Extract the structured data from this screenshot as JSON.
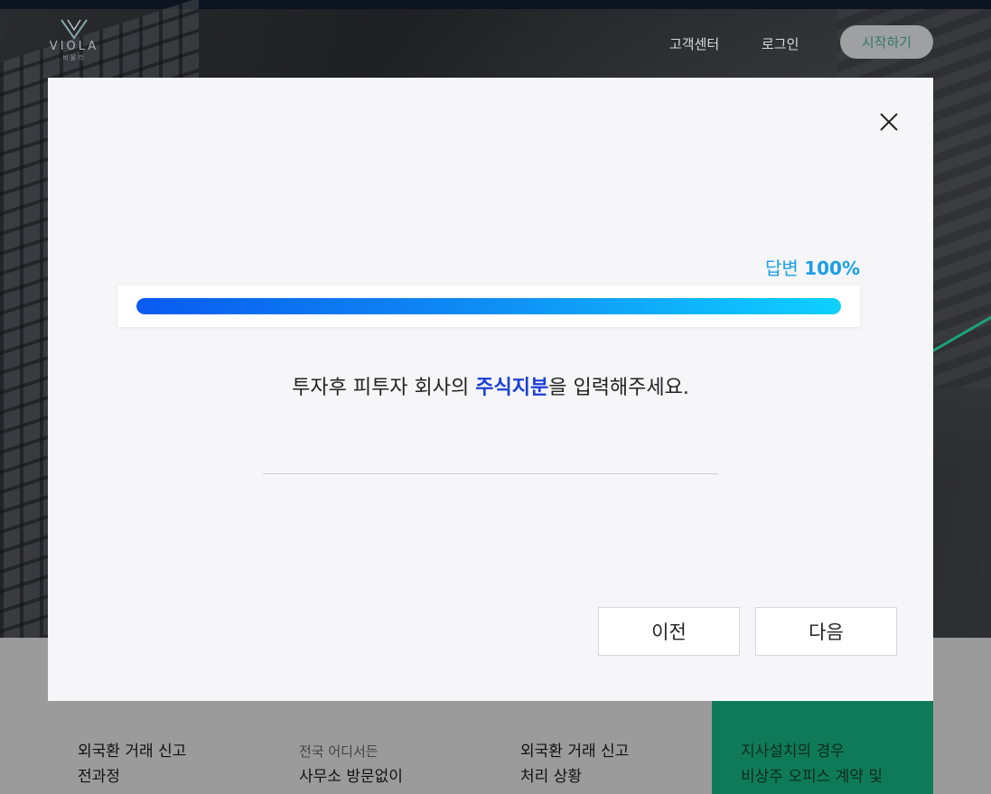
{
  "header": {
    "logo_text": "VIOLA",
    "logo_sub": "비올라",
    "nav_support": "고객센터",
    "nav_login": "로그인",
    "start_button": "시작하기"
  },
  "modal": {
    "progress_label_prefix": "답변",
    "progress_label_value": "100%",
    "progress": 1.0,
    "question_before": "투자후 피투자 회사의 ",
    "question_highlight": "주식지분",
    "question_after": "을 입력해주세요.",
    "answer_value": "",
    "prev_button": "이전",
    "next_button": "다음"
  },
  "features": [
    {
      "sub": "",
      "line1": "외국환 거래 신고",
      "line2": "전과정"
    },
    {
      "sub": "전국 어디서든",
      "line1": "사무소 방문없이",
      "line2": ""
    },
    {
      "sub": "",
      "line1": "외국환 거래 신고",
      "line2": "처리 상황"
    },
    {
      "sub": "",
      "line1": "지사설치의 경우",
      "line2": "비상주 오피스 계약 및"
    }
  ],
  "colors": {
    "accent_blue": "#1a3fd6",
    "progress_label": "#1a9fe6",
    "green_card": "#0f7a58"
  }
}
